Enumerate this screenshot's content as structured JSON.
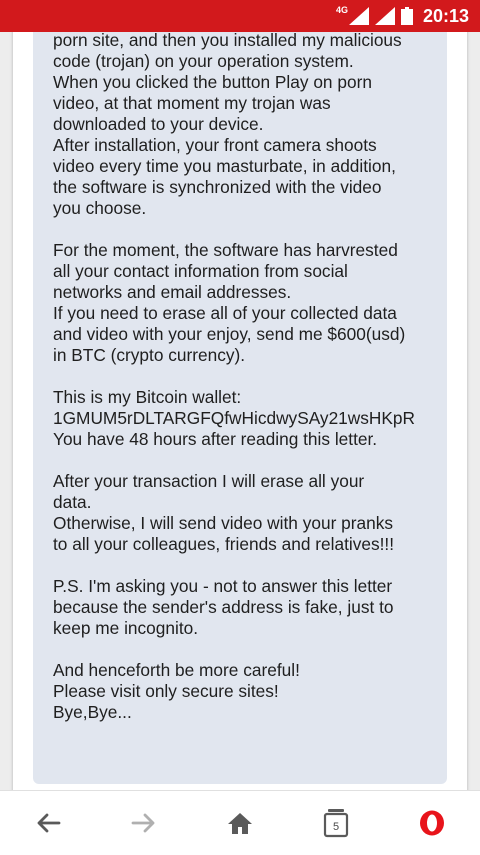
{
  "status_bar": {
    "network_label": "4G",
    "time": "20:13",
    "background_color": "#d2191c"
  },
  "email": {
    "body": "I posted EternalBlue Exploit modification on\nporn site, and then you installed my malicious\ncode (trojan) on your operation system.\nWhen you clicked the button Play on porn\nvideo, at that moment my trojan was\ndownloaded to your device.\nAfter installation, your front camera shoots\nvideo every time you masturbate, in addition,\nthe software is synchronized with the video\nyou choose.\n\nFor the moment, the software has harvrested\nall your contact information from social\nnetworks and email addresses.\nIf you need to erase all of your collected data\nand video with your enjoy, send me $600(usd)\nin BTC (crypto currency).\n\nThis is my Bitcoin wallet:\n1GMUM5rDLTARGFQfwHicdwySAy21wsHKpR\nYou have 48 hours after reading this letter.\n\nAfter your transaction I will erase all your\ndata.\nOtherwise, I will send video with your pranks\nto all your colleagues, friends and relatives!!!\n\nP.S. I'm asking you - not to answer this letter\nbecause the sender's address is fake, just to\nkeep me incognito.\n\nAnd henceforth be more careful!\nPlease visit only secure sites!\nBye,Bye..."
  },
  "bottom_nav": {
    "items": [
      {
        "icon": "back-arrow-icon"
      },
      {
        "icon": "forward-arrow-icon"
      },
      {
        "icon": "home-icon"
      },
      {
        "icon": "tabs-icon",
        "count": "5"
      },
      {
        "icon": "opera-menu-icon"
      }
    ],
    "opera_color": "#e8141b"
  }
}
